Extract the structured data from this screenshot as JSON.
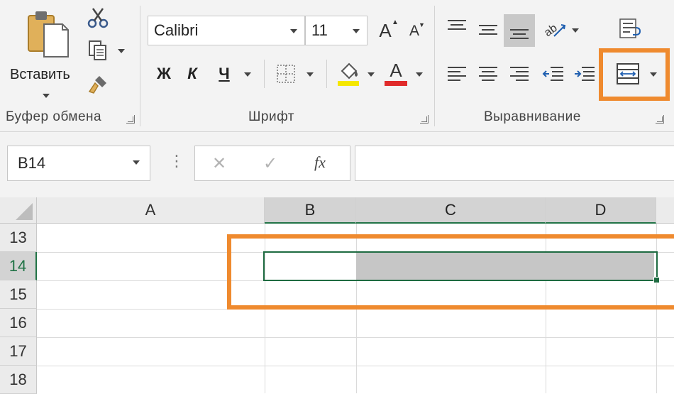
{
  "clipboard": {
    "paste_label": "Вставить",
    "group_label": "Буфер обмена"
  },
  "font": {
    "font_name": "Calibri",
    "font_size": "11",
    "bold_label": "Ж",
    "italic_label": "К",
    "underline_label": "Ч",
    "grow_label": "A",
    "shrink_label": "A",
    "font_color_label": "A",
    "group_label": "Шрифт",
    "highlight_color": "#f5e700",
    "font_color": "#e02b2b"
  },
  "alignment": {
    "group_label": "Выравнивание"
  },
  "formula_bar": {
    "name_box": "B14",
    "cancel_symbol": "✕",
    "enter_symbol": "✓",
    "fx_symbol": "fx",
    "more_symbol": "⋮",
    "formula_value": ""
  },
  "sheet": {
    "columns": [
      "A",
      "B",
      "C",
      "D"
    ],
    "rows": [
      "13",
      "14",
      "15",
      "16",
      "17",
      "18"
    ],
    "selected_cell": "B14"
  },
  "colors": {
    "accent": "#217346",
    "highlight": "#ef8a2e"
  }
}
